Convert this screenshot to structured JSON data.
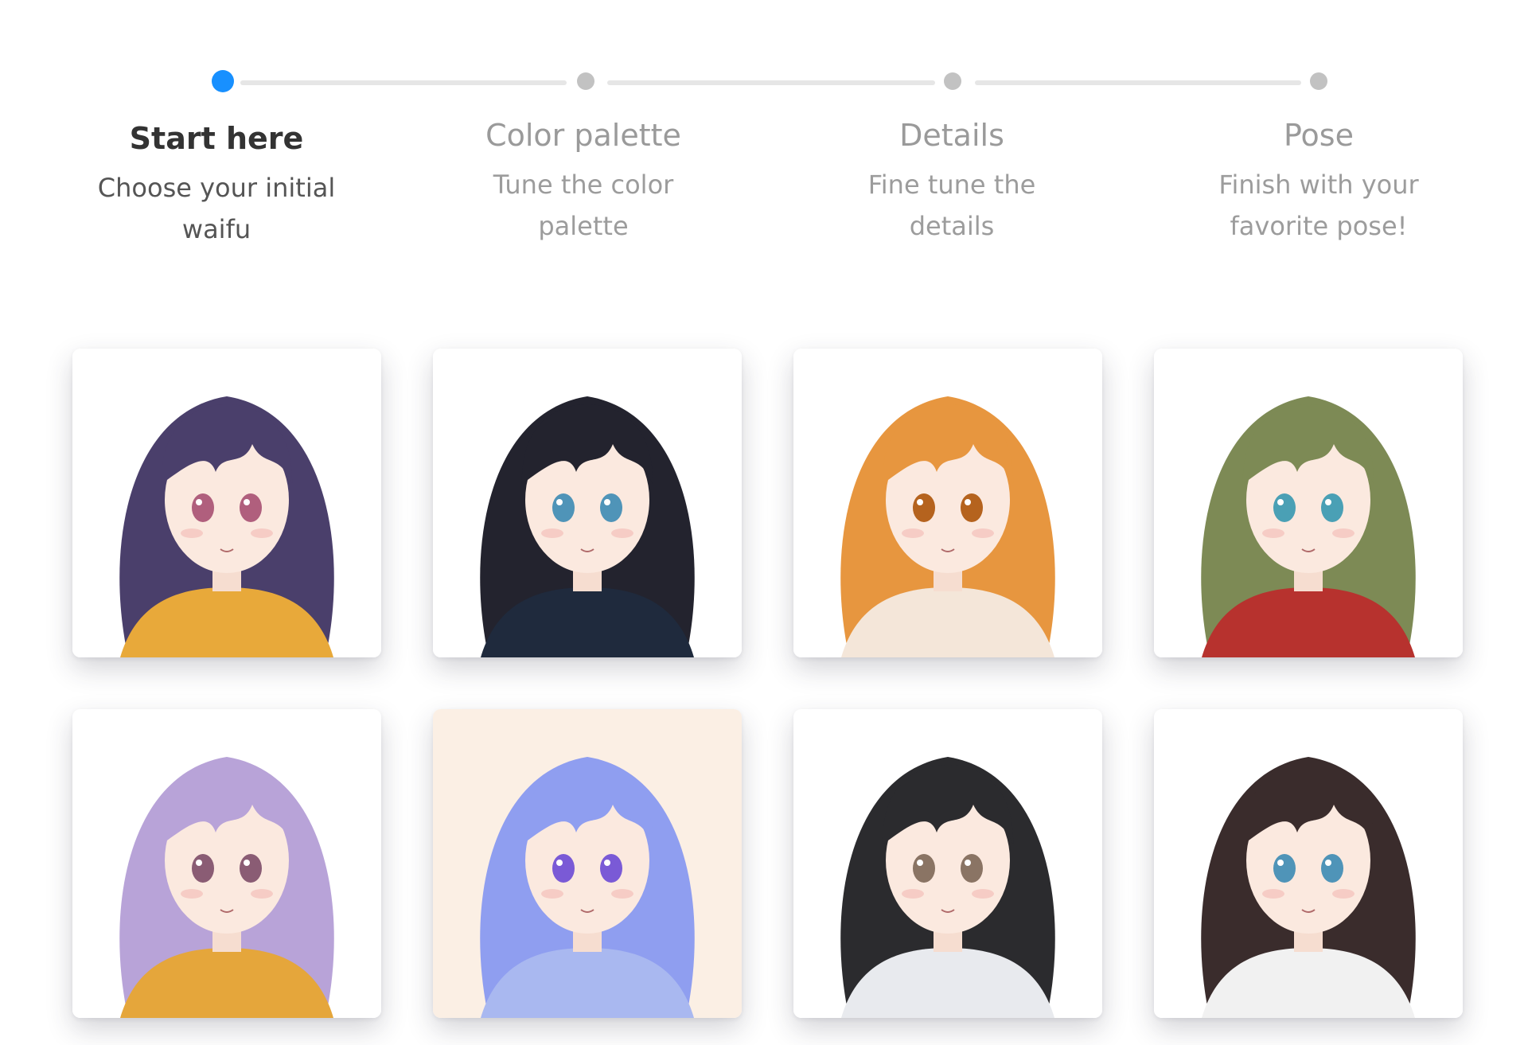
{
  "steps": [
    {
      "title": "Start here",
      "desc": "Choose your initial waifu",
      "state": "active"
    },
    {
      "title": "Color palette",
      "desc": "Tune the color palette",
      "state": "wait"
    },
    {
      "title": "Details",
      "desc": "Fine tune the details",
      "state": "wait"
    },
    {
      "title": "Pose",
      "desc": "Finish with your favorite pose!",
      "state": "wait"
    }
  ],
  "colors": {
    "accent": "#1890ff",
    "inactive_dot": "#c2c2c2"
  },
  "characters": [
    {
      "hair": "#4a3f6b",
      "eye": "#b05f7d",
      "outfit": "#e8a93a",
      "bg": "#ffffff"
    },
    {
      "hair": "#23232e",
      "eye": "#4f94b8",
      "outfit": "#1f2a3d",
      "bg": "#ffffff"
    },
    {
      "hair": "#e7963f",
      "eye": "#b5631e",
      "outfit": "#f4e6d9",
      "bg": "#ffffff"
    },
    {
      "hair": "#7d8a55",
      "eye": "#4aa0b5",
      "outfit": "#b7322e",
      "bg": "#ffffff"
    },
    {
      "hair": "#b8a3d8",
      "eye": "#8a5c74",
      "outfit": "#e5a63b",
      "bg": "#ffffff"
    },
    {
      "hair": "#8f9ef0",
      "eye": "#7a5ad6",
      "outfit": "#a9b8f0",
      "bg": "#fbefe4"
    },
    {
      "hair": "#2b2b2e",
      "eye": "#8a7464",
      "outfit": "#e8eaee",
      "bg": "#ffffff"
    },
    {
      "hair": "#3a2c2c",
      "eye": "#4f94b8",
      "outfit": "#f1f1f1",
      "bg": "#ffffff"
    }
  ]
}
